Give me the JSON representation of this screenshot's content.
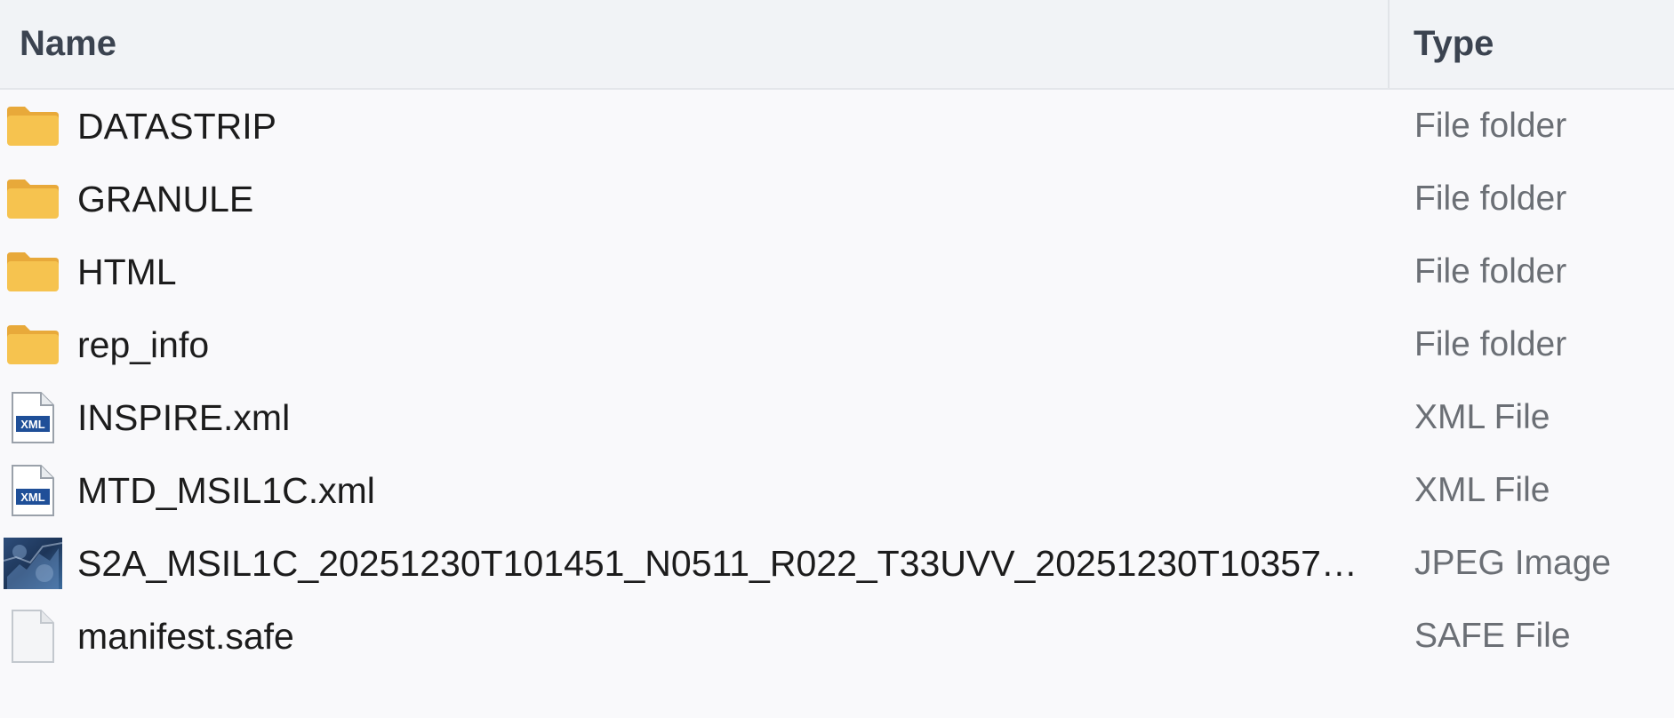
{
  "columns": {
    "name": "Name",
    "type": "Type"
  },
  "files": [
    {
      "name": "DATASTRIP",
      "type": "File folder",
      "icon": "folder-icon"
    },
    {
      "name": "GRANULE",
      "type": "File folder",
      "icon": "folder-icon"
    },
    {
      "name": "HTML",
      "type": "File folder",
      "icon": "folder-icon"
    },
    {
      "name": "rep_info",
      "type": "File folder",
      "icon": "folder-icon"
    },
    {
      "name": "INSPIRE.xml",
      "type": "XML File",
      "icon": "xml-file-icon"
    },
    {
      "name": "MTD_MSIL1C.xml",
      "type": "XML File",
      "icon": "xml-file-icon"
    },
    {
      "name": "S2A_MSIL1C_20251230T101451_N0511_R022_T33UVV_20251230T10357…",
      "type": "JPEG Image",
      "icon": "jpeg-thumbnail-icon"
    },
    {
      "name": "manifest.safe",
      "type": "SAFE File",
      "icon": "blank-file-icon"
    }
  ],
  "xml_badge": "XML",
  "colors": {
    "folder": "#f6c34f",
    "xml_badge": "#1f4f98",
    "header_bg": "#f1f3f6",
    "type_text": "#6b6f75"
  }
}
